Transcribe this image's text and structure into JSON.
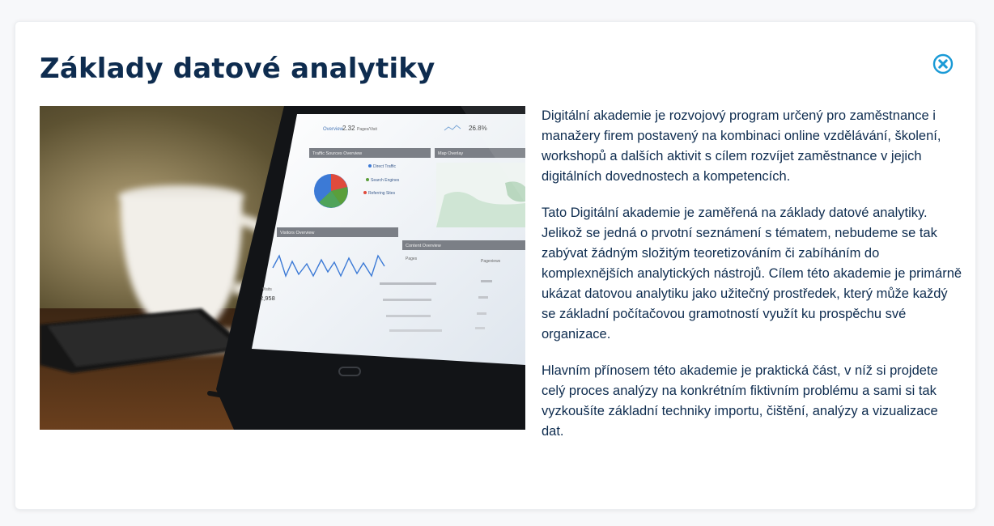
{
  "modal": {
    "title": "Základy datové analytiky",
    "close_icon": "close-circle-icon",
    "image": {
      "kind": "photo-tablet-analytics-dashboard",
      "screen_panels": [
        "Traffic Sources Overview",
        "Map Overlay",
        "Visitors Overview",
        "Content Overview"
      ],
      "screen_labels": {
        "pages_visit": "2.32",
        "pages_visit_label": "Pages/Visit",
        "percent": "26.8%",
        "legend": [
          "Direct Traffic",
          "Search Engines",
          "Referring Sites"
        ],
        "visits_label": "Visits",
        "visits_value": "2,958",
        "table_header_left": "Pages",
        "table_header_right": "Pageviews"
      }
    },
    "paragraphs": [
      "Digitální akademie je rozvojový program určený pro zaměstnance i manažery firem postavený na kombinaci online vzdělávání, školení, workshopů a dalších aktivit s cílem rozvíjet zaměstnance v jejich digitálních dovednostech a kompetencích.",
      "Tato Digitální akademie je zaměřená na základy datové analytiky. Jelikož se jedná o prvotní seznámení s tématem, nebudeme se tak zabývat žádným složitým teoretizováním či zabíháním do komplexnějších analytických nástrojů. Cílem této akademie je primárně ukázat datovou analytiku jako užitečný prostředek, který může každý se základní počítačovou gramotností využít ku prospěchu své organizace.",
      "Hlavním přínosem této akademie je praktická část, v níž si projdete celý proces analýzy na konkrétním fiktivním problému a sami si tak vyzkoušíte základní techniky importu, čištění, analýzy a vizualizace dat."
    ]
  },
  "colors": {
    "title": "#0e2c4f",
    "body_text": "#0e2c4f",
    "close_accent": "#1a9ad6",
    "page_bg": "#f7f8fa"
  }
}
